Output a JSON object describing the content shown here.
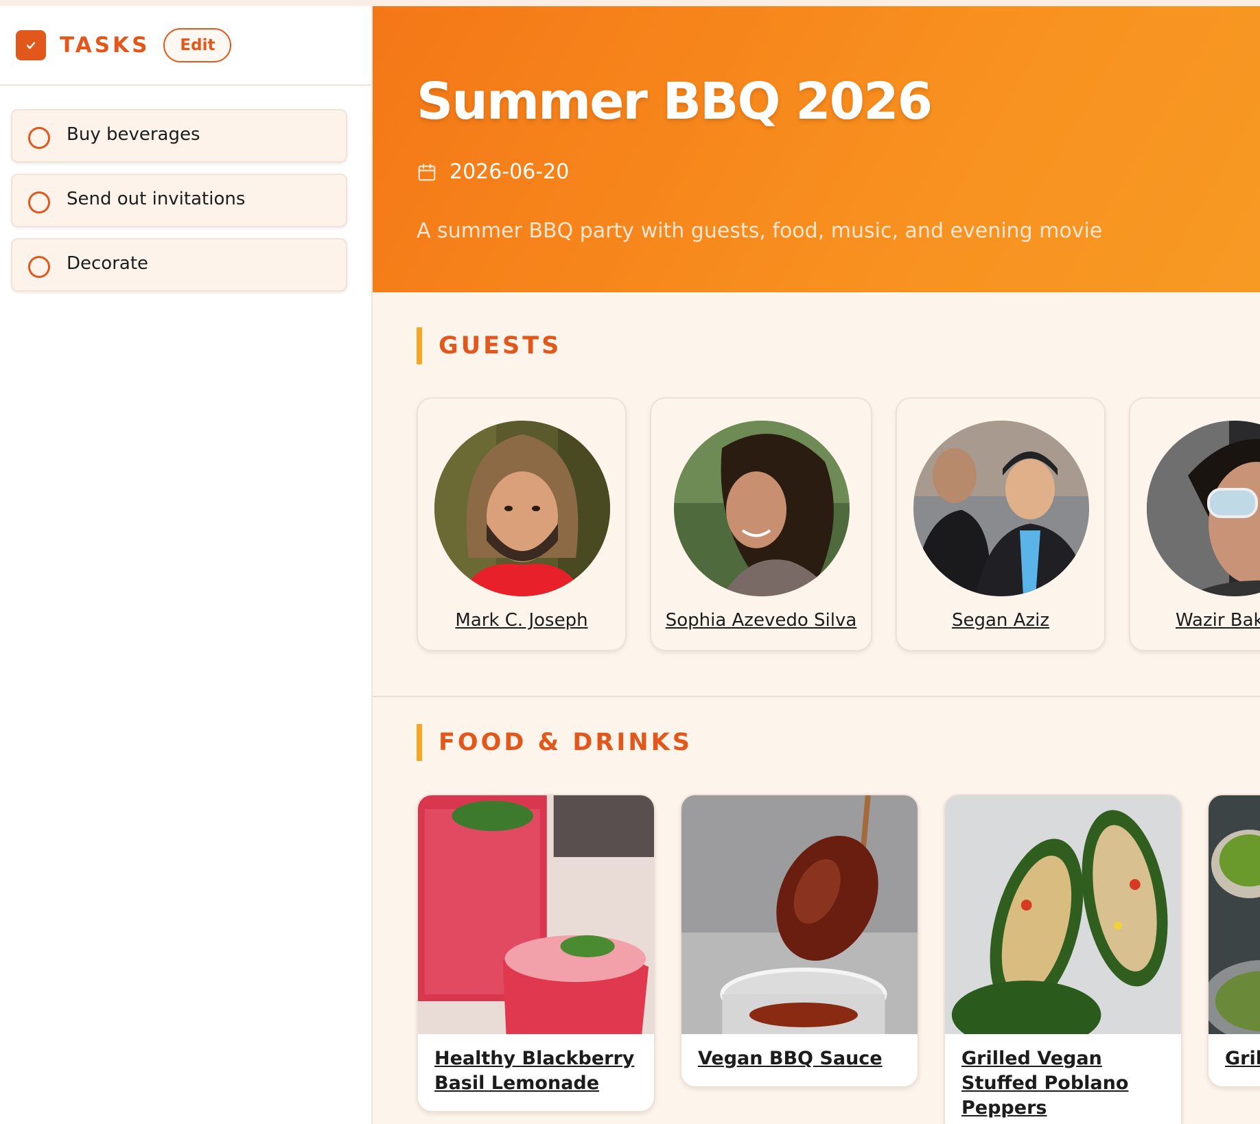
{
  "sidebar": {
    "title": "TASKS",
    "edit_label": "Edit",
    "tasks": [
      {
        "label": "Buy beverages"
      },
      {
        "label": "Send out invitations"
      },
      {
        "label": "Decorate"
      }
    ]
  },
  "event": {
    "title": "Summer BBQ 2026",
    "date": "2026-06-20",
    "description": "A summer BBQ party with guests, food, music, and evening movie"
  },
  "guests": {
    "heading": "GUESTS",
    "items": [
      {
        "name": "Mark C. Joseph"
      },
      {
        "name": "Sophia Azevedo Silva"
      },
      {
        "name": "Segan Aziz"
      },
      {
        "name": "Wazir Bakr M"
      }
    ]
  },
  "food": {
    "heading": "FOOD & DRINKS",
    "items": [
      {
        "title": "Healthy Blackberry Basil Lemonade"
      },
      {
        "title": "Vegan BBQ Sauce"
      },
      {
        "title": "Grilled Vegan Stuffed Poblano Peppers"
      },
      {
        "title": "Grill"
      }
    ]
  },
  "colors": {
    "accent": "#e2581c",
    "hero_gradient_start": "#f47717",
    "hero_gradient_end": "#f79a24",
    "section_bar": "#f5a623",
    "page_background": "#fdf4ec"
  }
}
